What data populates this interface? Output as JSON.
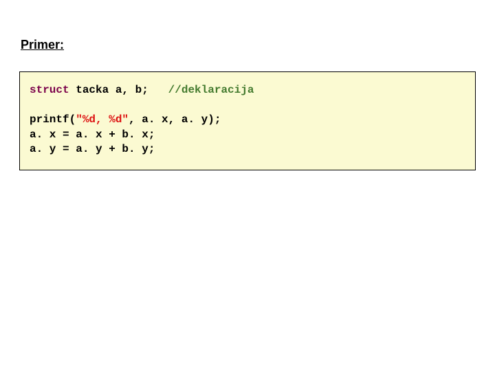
{
  "heading": "Primer:",
  "code": {
    "l1_kw": "struct",
    "l1_rest": " tacka a, b;   ",
    "l1_comment": "//deklaracija",
    "blank": " ",
    "l2_pre": "printf(",
    "l2_str": "\"%d, %d\"",
    "l2_post": ", a. x, a. y);",
    "l3": "a. x = a. x + b. x;",
    "l4": "a. y = a. y + b. y;"
  }
}
